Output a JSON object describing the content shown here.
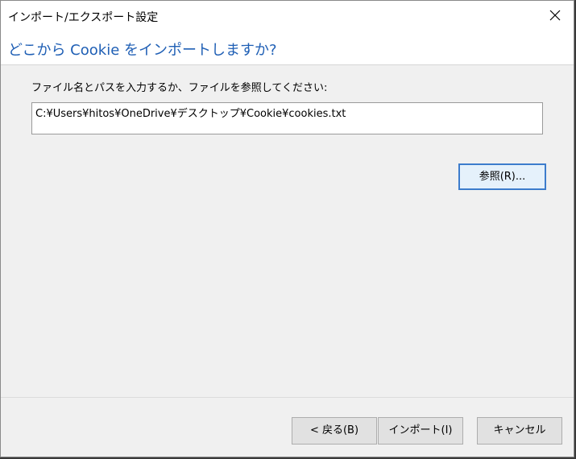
{
  "window": {
    "title": "インポート/エクスポート設定"
  },
  "header": {
    "title": "どこから Cookie をインポートしますか?"
  },
  "main": {
    "instruction": "ファイル名とパスを入力するか、ファイルを参照してください:",
    "path_value": "C:¥Users¥hitos¥OneDrive¥デスクトップ¥Cookie¥cookies.txt",
    "browse_label": "参照(R)..."
  },
  "footer": {
    "back_label": "< 戻る(B)",
    "import_label": "インポート(I)",
    "cancel_label": "キャンセル"
  },
  "colors": {
    "header_text": "#1f5fb5",
    "focus_border": "#3c7ccc"
  },
  "icons": {
    "close": "close-icon"
  }
}
